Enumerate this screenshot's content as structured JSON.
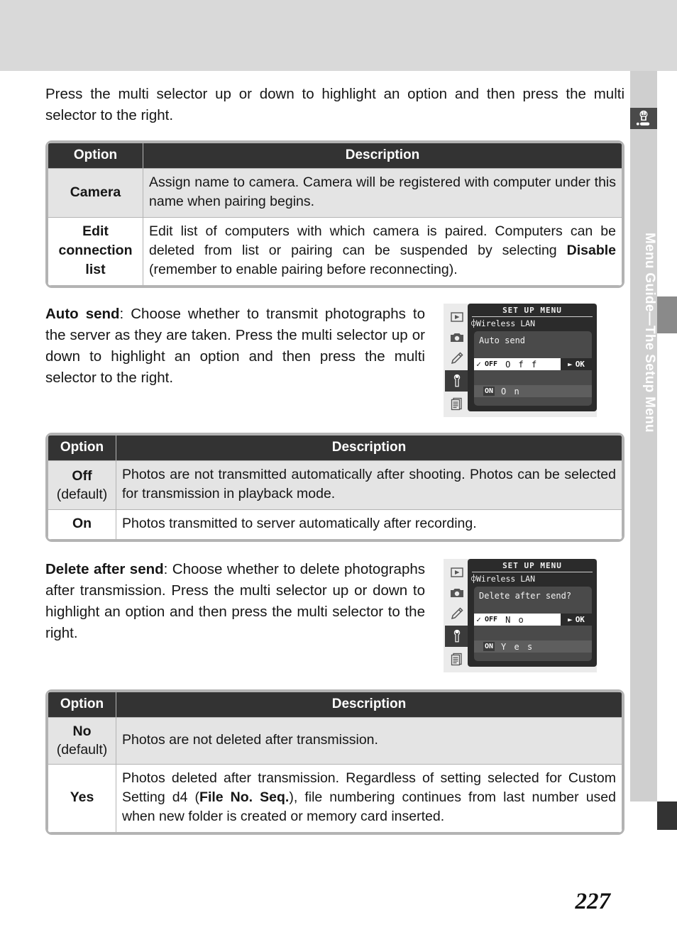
{
  "sidebar": {
    "icon": "wrench-icon",
    "label": "Menu Guide—The Setup Menu"
  },
  "page": {
    "number": "227"
  },
  "intro": {
    "text": "Press the multi selector up or down to highlight an option and then press the multi selector to the right."
  },
  "table1": {
    "headers": {
      "option": "Option",
      "description": "Description"
    },
    "rows": [
      {
        "option": "Camera",
        "sub": "",
        "description_html": "Assign name to camera.  Camera will be registered with computer under this name when pairing begins."
      },
      {
        "option": "Edit connection list",
        "sub": "",
        "description_html": "Edit list of computers with which camera is paired.  Computers can be deleted from list or pairing can be suspended by selecting <b>Disable</b> (remember to enable pairing before reconnecting)."
      }
    ]
  },
  "autosend": {
    "paragraph_html": "<b>Auto send</b>: Choose whether to transmit photographs to the server as they are taken.  Press the multi selector up or down to highlight an option and then press the multi selector to the right.",
    "lcd": {
      "title": "SET UP MENU",
      "submenu": "Wireless LAN",
      "antenna_icon": "antenna-icon",
      "prompt": "Auto send",
      "selected": {
        "check": "✓",
        "badge": "OFF",
        "label": "O f f"
      },
      "unselected": {
        "badge": "ON",
        "label": "O n"
      },
      "ok_button": "OK",
      "ok_arrow": "►",
      "icons": [
        "playback-icon",
        "camera-icon",
        "pencil-icon",
        "wrench-icon",
        "recent-settings-icon"
      ]
    }
  },
  "table2": {
    "headers": {
      "option": "Option",
      "description": "Description"
    },
    "rows": [
      {
        "option": "Off",
        "sub": "(default)",
        "description_html": "Photos are not transmitted automatically after shooting.  Photos can be selected for transmission in playback mode."
      },
      {
        "option": "On",
        "sub": "",
        "description_html": "Photos transmitted to server automatically after recording."
      }
    ]
  },
  "deleteaftersend": {
    "paragraph_html": "<b>Delete after send</b>: Choose whether to delete photographs after transmission.  Press the multi selector up or down to highlight an option and then press the multi selector to the right.",
    "lcd": {
      "title": "SET UP MENU",
      "submenu": "Wireless LAN",
      "antenna_icon": "antenna-icon",
      "prompt": "Delete after send?",
      "selected": {
        "check": "✓",
        "badge": "OFF",
        "label": "N o"
      },
      "unselected": {
        "badge": "ON",
        "label": "Y e s"
      },
      "ok_button": "OK",
      "ok_arrow": "►",
      "icons": [
        "playback-icon",
        "camera-icon",
        "pencil-icon",
        "wrench-icon",
        "recent-settings-icon"
      ]
    }
  },
  "table3": {
    "headers": {
      "option": "Option",
      "description": "Description"
    },
    "rows": [
      {
        "option": "No",
        "sub": "(default)",
        "description_html": "Photos are not deleted after transmission."
      },
      {
        "option": "Yes",
        "sub": "",
        "description_html": "Photos deleted after transmission.  Regardless of setting selected for Custom Setting d4 (<b>File No. Seq.</b>), file numbering continues from last number used when new folder is created or memory card inserted."
      }
    ]
  }
}
